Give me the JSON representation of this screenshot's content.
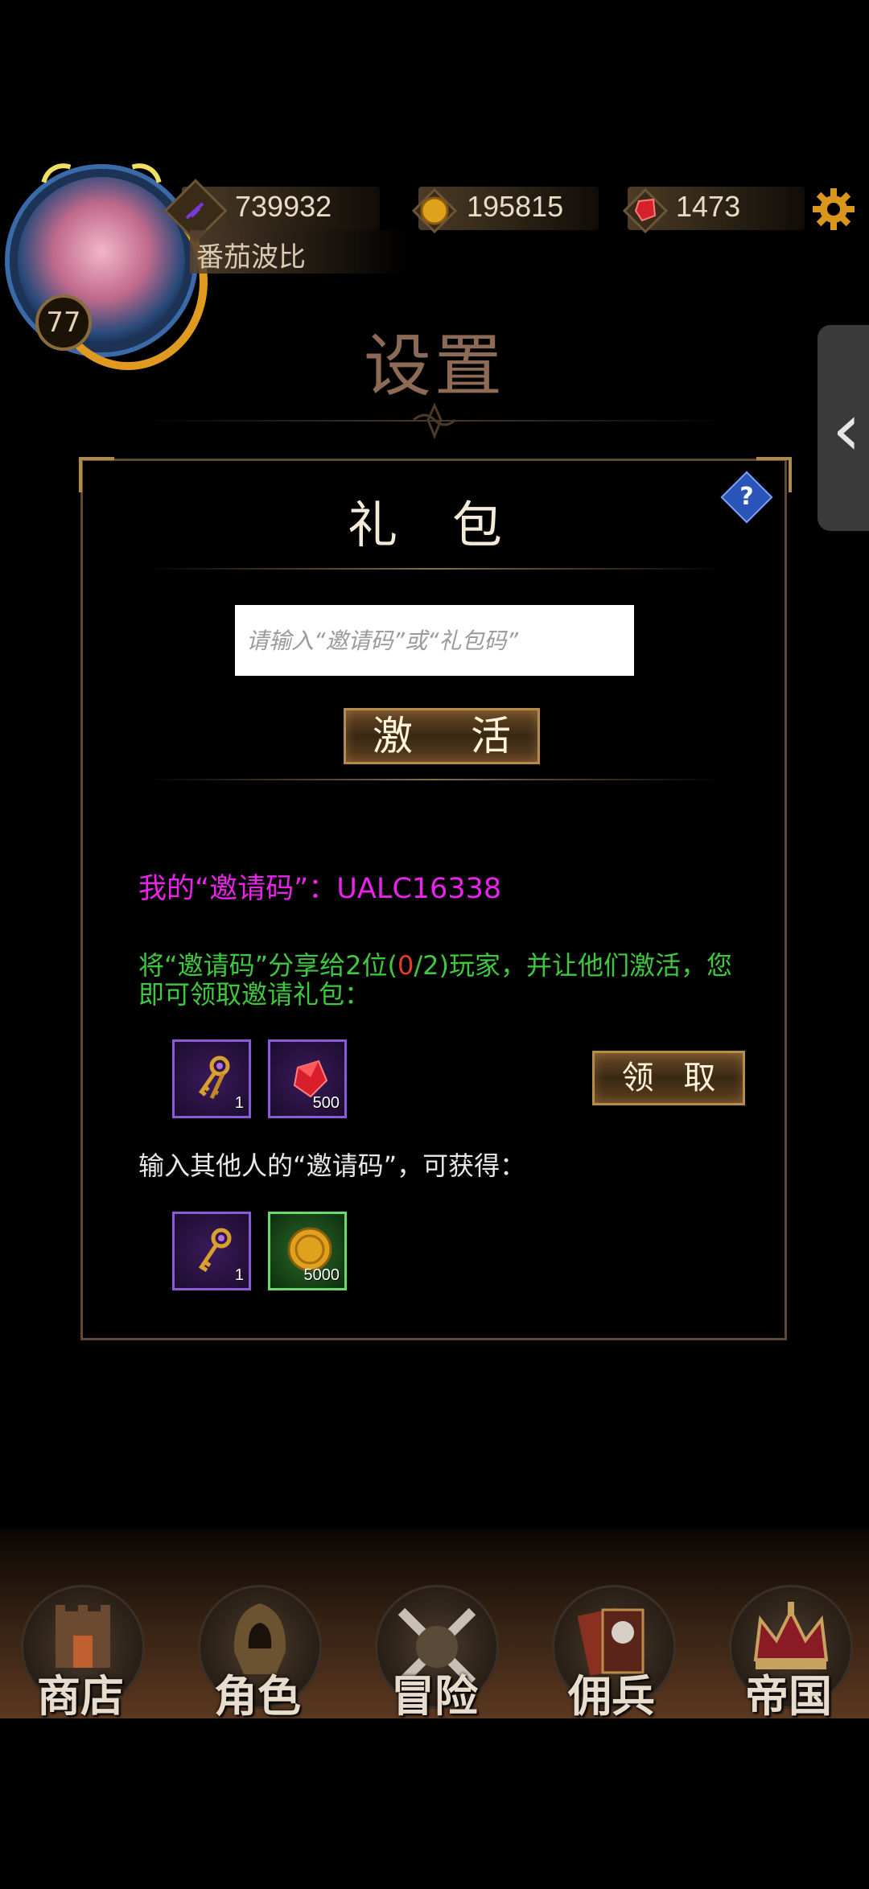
{
  "hud": {
    "level": "77",
    "player_name": "番茄波比",
    "resources": {
      "power": "739932",
      "gold": "195815",
      "gems": "1473"
    }
  },
  "page_title": "设置",
  "panel": {
    "title": "礼 包",
    "help_label": "?",
    "code_input_placeholder": "请输入“邀请码”或“礼包码”",
    "activate_label": "激 活",
    "invite_code_text": "我的“邀请码”：UALC16338",
    "share_desc_pre": "将“邀请码”分享给2位(",
    "share_desc_count": "0",
    "share_desc_post": "/2)玩家，并让他们激活，您即可领取邀请礼包：",
    "claim_label": "领 取",
    "other_desc": "输入其他人的“邀请码”，可获得：",
    "invite_rewards": [
      {
        "icon": "keys-icon",
        "qty": "1"
      },
      {
        "icon": "red-gem-icon",
        "qty": "500"
      }
    ],
    "input_rewards": [
      {
        "icon": "key-icon",
        "qty": "1"
      },
      {
        "icon": "gold-coin-icon",
        "qty": "5000"
      }
    ]
  },
  "bottom_nav": [
    {
      "label": "商店",
      "icon": "shop-icon"
    },
    {
      "label": "角色",
      "icon": "character-icon"
    },
    {
      "label": "冒险",
      "icon": "adventure-icon"
    },
    {
      "label": "佣兵",
      "icon": "mercenary-icon"
    },
    {
      "label": "帝国",
      "icon": "empire-icon"
    }
  ],
  "colors": {
    "invite_code": "#ea23ea",
    "share_desc": "#3ec83e",
    "count_highlight": "#e23b2a",
    "title": "#8d6a55"
  }
}
